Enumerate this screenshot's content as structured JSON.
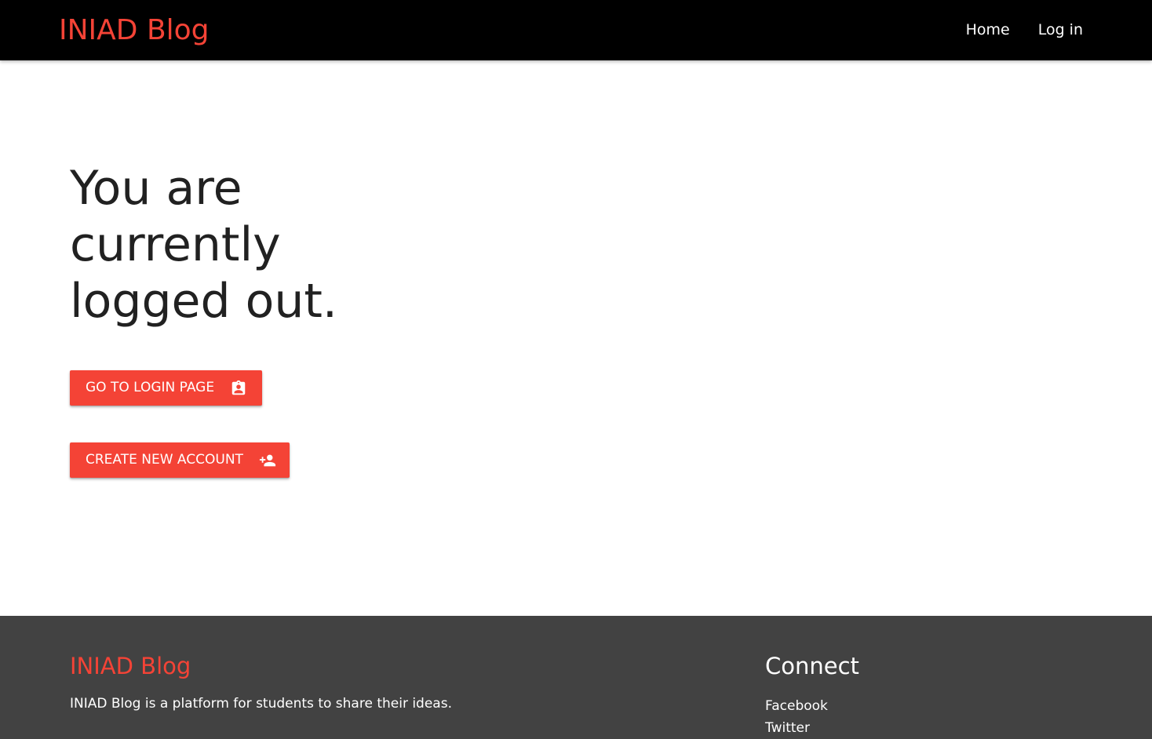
{
  "colors": {
    "accent": "#f44336",
    "navbar_bg": "#000000",
    "footer_bg": "#424242",
    "text_dark": "#212121",
    "text_light": "#ffffff"
  },
  "navbar": {
    "brand": "INIAD Blog",
    "links": [
      {
        "label": "Home"
      },
      {
        "label": "Log in"
      }
    ]
  },
  "main": {
    "heading": "You are currently logged out.",
    "buttons": [
      {
        "label": "GO TO LOGIN PAGE",
        "icon": "assignment-ind-icon"
      },
      {
        "label": "CREATE NEW ACCOUNT",
        "icon": "person-add-icon"
      }
    ]
  },
  "footer": {
    "brand": "INIAD Blog",
    "description": "INIAD Blog is a platform for students to share their ideas.",
    "connect_title": "Connect",
    "links": [
      {
        "label": "Facebook"
      },
      {
        "label": "Twitter"
      }
    ]
  }
}
